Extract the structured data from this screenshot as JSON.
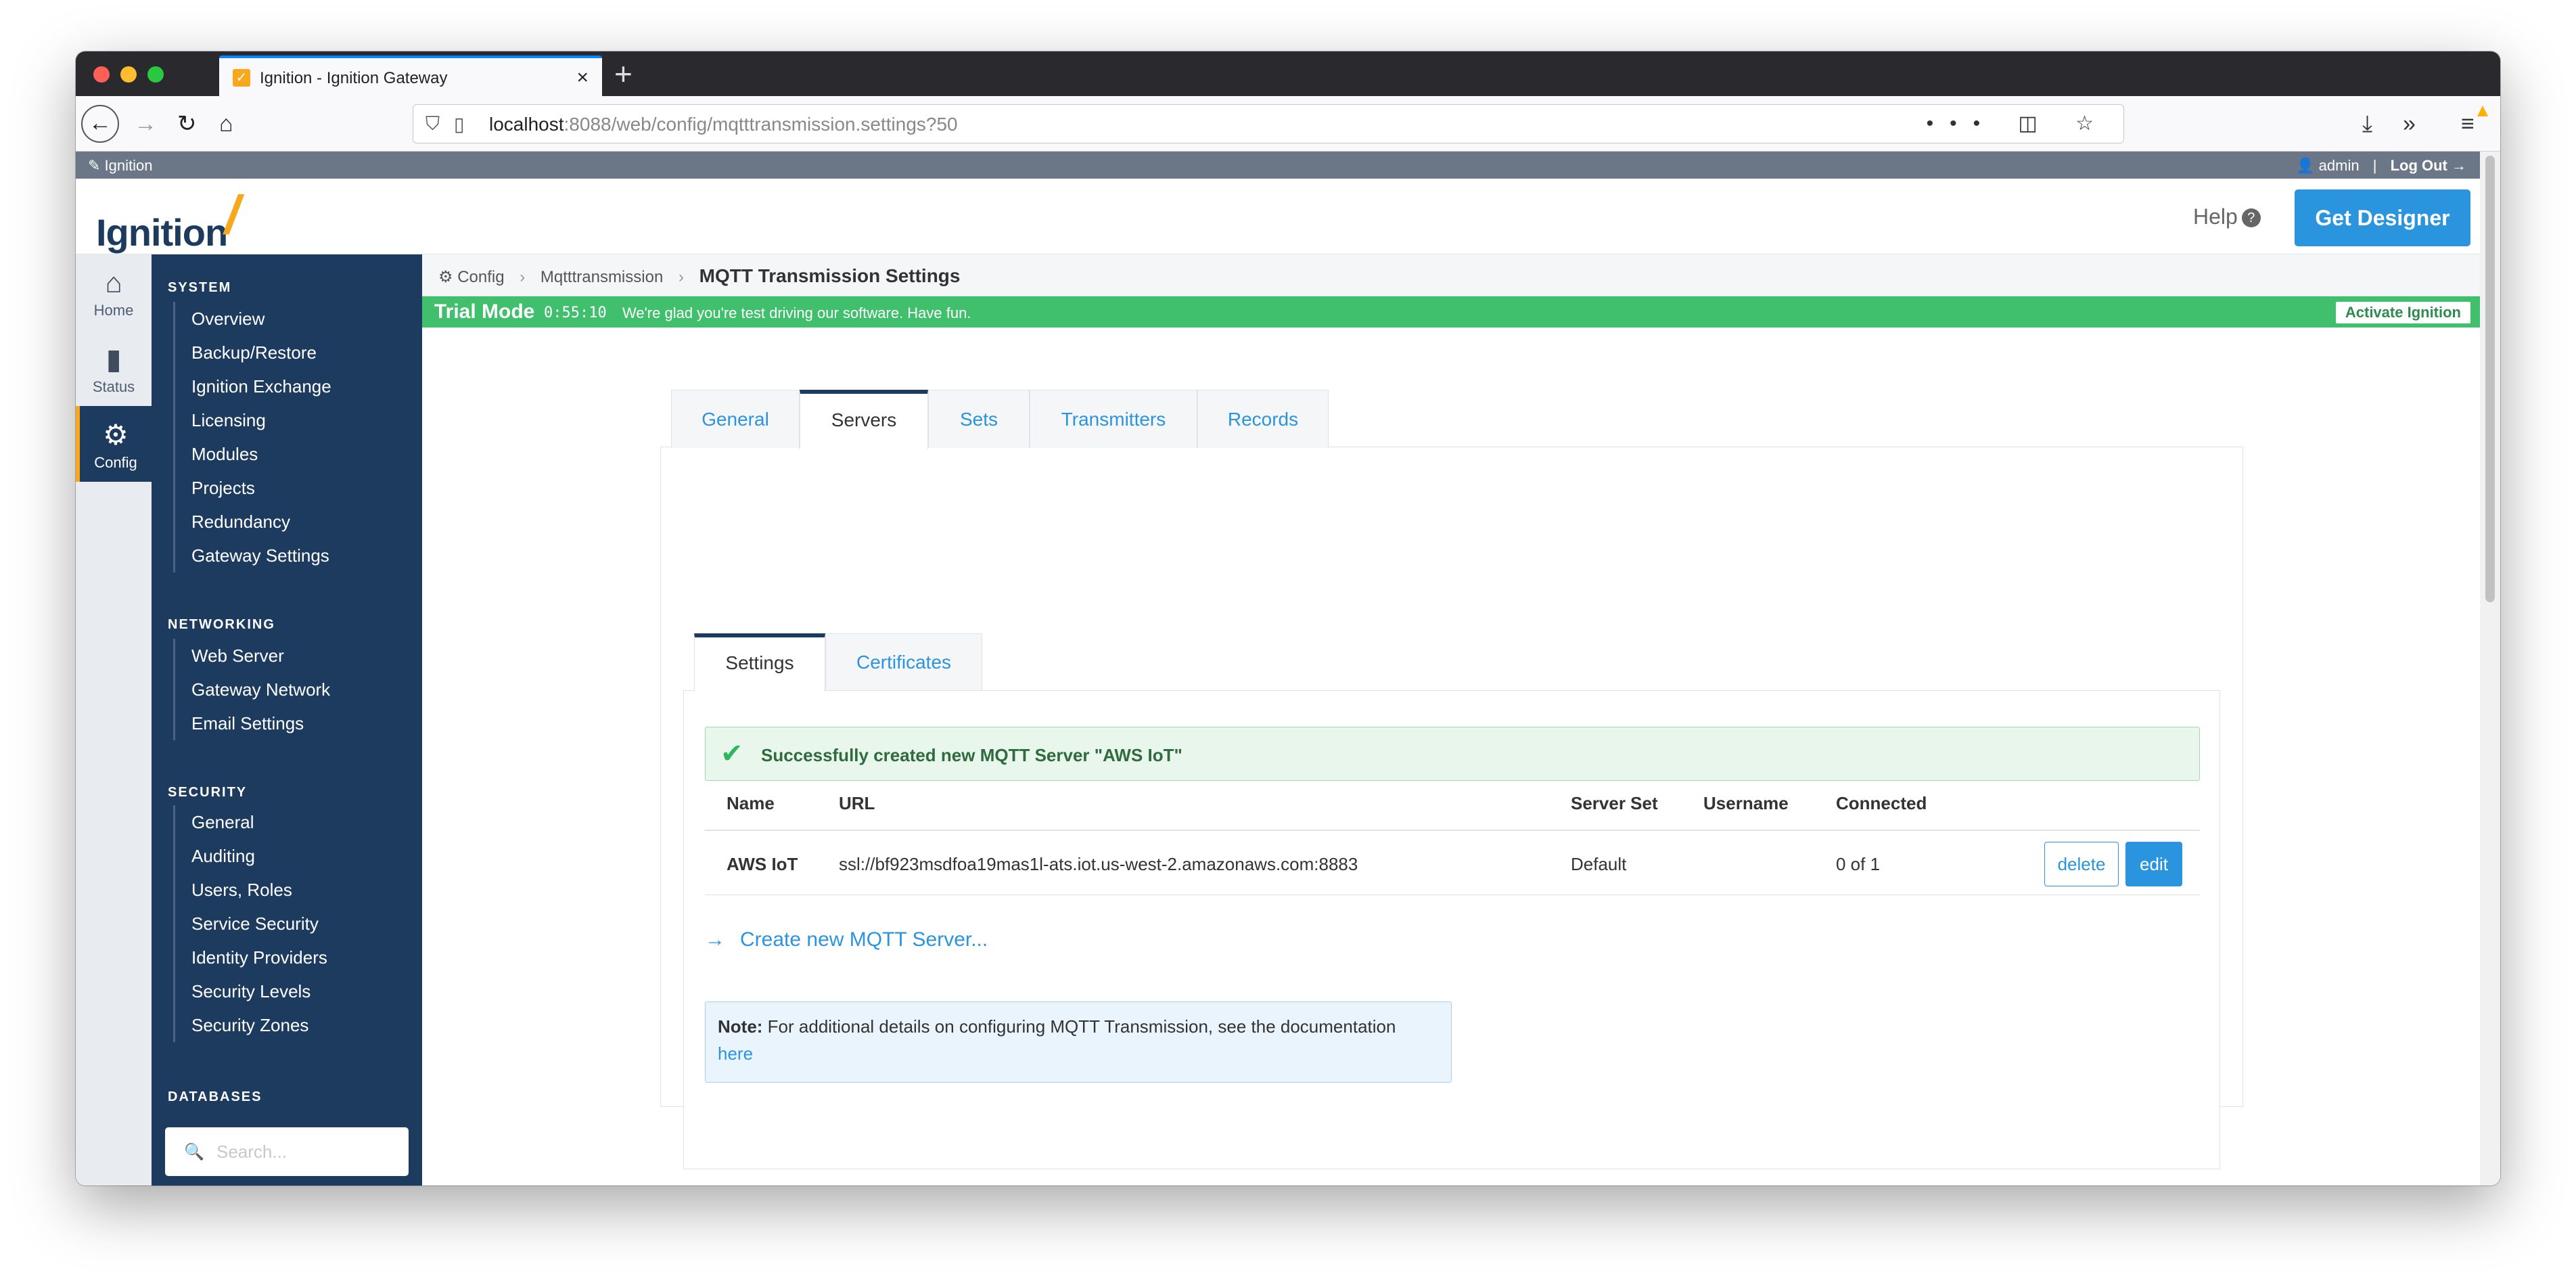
{
  "browser": {
    "tab_title": "Ignition - Ignition Gateway",
    "tab_favicon": "✓",
    "new_tab_icon": "+",
    "url_host": "localhost",
    "url_rest": ":8088/web/config/mqtttransmission.settings?50",
    "url_actions": "••• ◫ ☆"
  },
  "app": {
    "top_strip_label": "Ignition",
    "user": "admin",
    "logout": "Log Out",
    "logo_text": "Ignition",
    "help": "Help",
    "get_designer": "Get Designer"
  },
  "rail": [
    {
      "label": "Home",
      "icon": "home-icon"
    },
    {
      "label": "Status",
      "icon": "status-icon"
    },
    {
      "label": "Config",
      "icon": "gear-icon"
    }
  ],
  "sidebar": {
    "sections": [
      {
        "title": "SYSTEM",
        "items": [
          "Overview",
          "Backup/Restore",
          "Ignition Exchange",
          "Licensing",
          "Modules",
          "Projects",
          "Redundancy",
          "Gateway Settings"
        ]
      },
      {
        "title": "NETWORKING",
        "items": [
          "Web Server",
          "Gateway Network",
          "Email Settings"
        ]
      },
      {
        "title": "SECURITY",
        "items": [
          "General",
          "Auditing",
          "Users, Roles",
          "Service Security",
          "Identity Providers",
          "Security Levels",
          "Security Zones"
        ]
      },
      {
        "title": "DATABASES",
        "items": []
      }
    ],
    "search_placeholder": "Search..."
  },
  "breadcrumb": {
    "items": [
      "Config",
      "Mqtttransmission"
    ],
    "current": "MQTT Transmission Settings"
  },
  "trial": {
    "title": "Trial Mode",
    "time": "0:55:10",
    "message": "We're glad you're test driving our software. Have fun.",
    "activate": "Activate Ignition"
  },
  "outer_tabs": [
    "General",
    "Servers",
    "Sets",
    "Transmitters",
    "Records"
  ],
  "outer_tab_active": "Servers",
  "inner_tabs": [
    "Settings",
    "Certificates"
  ],
  "inner_tab_active": "Settings",
  "success_message": "Successfully created new MQTT Server \"AWS IoT\"",
  "table": {
    "columns": [
      "Name",
      "URL",
      "Server Set",
      "Username",
      "Connected"
    ],
    "rows": [
      {
        "name": "AWS IoT",
        "url": "ssl://bf923msdfoa19mas1l-ats.iot.us-west-2.amazonaws.com:8883",
        "server_set": "Default",
        "username": "",
        "connected": "0 of 1",
        "delete": "delete",
        "edit": "edit"
      }
    ]
  },
  "create_link": "Create new MQTT Server...",
  "note": {
    "label": "Note:",
    "text": "For additional details on configuring MQTT Transmission, see the documentation",
    "link": "here"
  },
  "colors": {
    "navy": "#1d3b5f",
    "accent_blue": "#2a94df",
    "trial_green": "#40bf6c",
    "logo_orange": "#f8a81d"
  }
}
